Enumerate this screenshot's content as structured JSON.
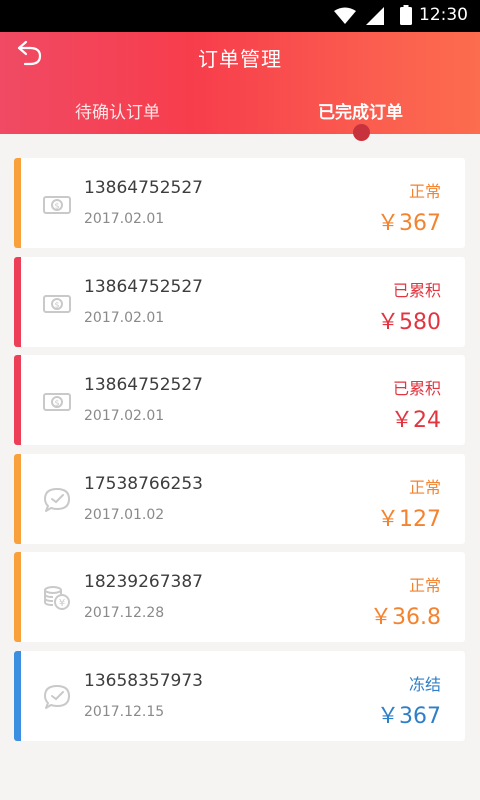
{
  "status_bar": {
    "time": "12:30"
  },
  "header": {
    "title": "订单管理"
  },
  "tabs": [
    {
      "label": "待确认订单",
      "active": false
    },
    {
      "label": "已完成订单",
      "active": true
    }
  ],
  "orders": [
    {
      "phone": "13864752527",
      "date": "2017.02.01",
      "status": "正常",
      "amount": "￥367",
      "icon": "banknote-icon",
      "accent": "#f7a03c",
      "status_color": "#f3832f",
      "amount_color": "#f3832f"
    },
    {
      "phone": "13864752527",
      "date": "2017.02.01",
      "status": "已累积",
      "amount": "￥580",
      "icon": "banknote-icon",
      "accent": "#ec3e56",
      "status_color": "#e2353f",
      "amount_color": "#e2353f"
    },
    {
      "phone": "13864752527",
      "date": "2017.02.01",
      "status": "已累积",
      "amount": "￥24",
      "icon": "banknote-icon",
      "accent": "#ec3e56",
      "status_color": "#e2353f",
      "amount_color": "#e2353f"
    },
    {
      "phone": "17538766253",
      "date": "2017.01.02",
      "status": "正常",
      "amount": "￥127",
      "icon": "chat-check-icon",
      "accent": "#f7a03c",
      "status_color": "#f3832f",
      "amount_color": "#f3832f"
    },
    {
      "phone": "18239267387",
      "date": "2017.12.28",
      "status": "正常",
      "amount": "￥36.8",
      "icon": "coins-icon",
      "accent": "#f7a03c",
      "status_color": "#f3832f",
      "amount_color": "#f3832f"
    },
    {
      "phone": "13658357973",
      "date": "2017.12.15",
      "status": "冻结",
      "amount": "￥367",
      "icon": "chat-check-icon",
      "accent": "#3b8ee0",
      "status_color": "#2f7fc8",
      "amount_color": "#2f7fc8"
    }
  ]
}
